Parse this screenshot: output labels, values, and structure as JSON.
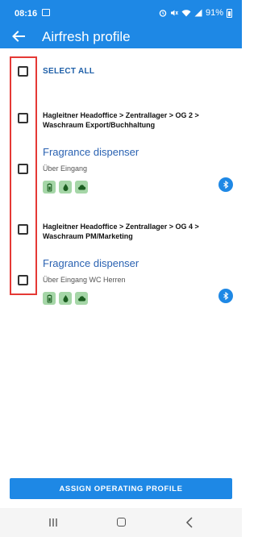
{
  "status_bar": {
    "time": "08:16",
    "battery": "91%"
  },
  "app_bar": {
    "title": "Airfresh profile"
  },
  "select_all": {
    "label": "SELECT ALL",
    "checked": false
  },
  "groups": [
    {
      "path": "Hagleitner Headoffice > Zentrallager > OG 2 > Waschraum Export/Buchhaltung",
      "checked": false,
      "device": {
        "name": "Fragrance dispenser",
        "location": "Über Eingang",
        "checked": false,
        "features": [
          "battery-icon",
          "drop-icon",
          "cloud-icon"
        ]
      }
    },
    {
      "path": "Hagleitner Headoffice > Zentrallager > OG 4 > Waschraum PM/Marketing",
      "checked": false,
      "device": {
        "name": "Fragrance dispenser",
        "location": "Über Eingang WC Herren",
        "checked": false,
        "features": [
          "battery-icon",
          "drop-icon",
          "cloud-icon"
        ]
      }
    }
  ],
  "assign_button": {
    "label": "ASSIGN OPERATING PROFILE"
  },
  "colors": {
    "primary": "#1e88e5",
    "title": "#2a62b2",
    "feature_bg": "#a5d6a7",
    "highlight": "#e53935"
  }
}
